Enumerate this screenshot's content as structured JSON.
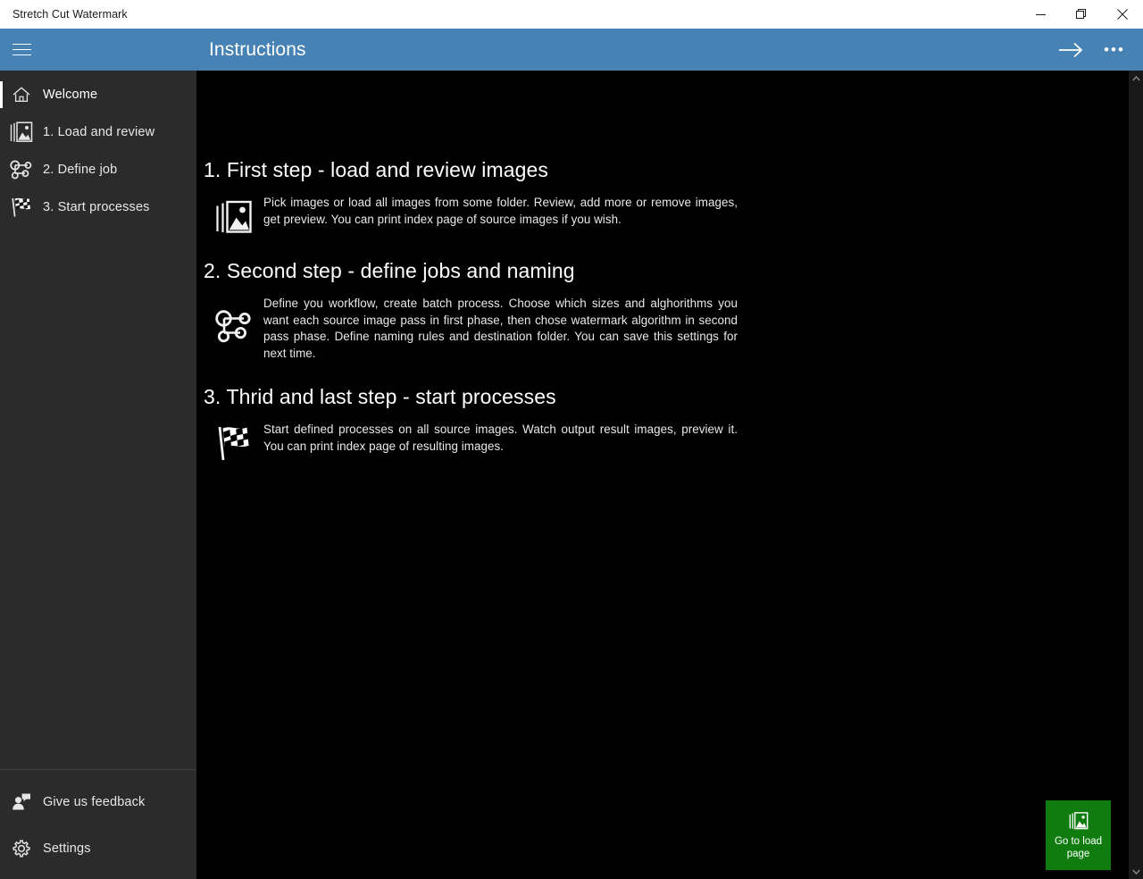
{
  "window": {
    "title": "Stretch Cut Watermark",
    "controls": [
      {
        "name": "minimize",
        "label": "—"
      },
      {
        "name": "maximize",
        "label": "❐"
      },
      {
        "name": "close",
        "label": "✕"
      }
    ]
  },
  "appbar": {
    "menu_icon": "hamburger-icon",
    "title": "Instructions",
    "forward_icon": "arrow-right-icon",
    "more_label": "•••"
  },
  "sidebar": {
    "items": [
      {
        "label": "Welcome",
        "icon": "home-icon",
        "selected": true
      },
      {
        "label": "1. Load and review",
        "icon": "images-icon",
        "selected": false
      },
      {
        "label": "2. Define job",
        "icon": "share-nodes-icon",
        "selected": false
      },
      {
        "label": "3. Start processes",
        "icon": "checkered-flag-icon",
        "selected": false
      }
    ],
    "bottom_items": [
      {
        "label": "Give us feedback",
        "icon": "feedback-person-icon"
      },
      {
        "label": "Settings",
        "icon": "gear-icon"
      }
    ]
  },
  "main": {
    "sections": [
      {
        "title": "1. First step - load and review images",
        "icon": "images-icon",
        "text": "Pick images or load all images from some folder. Review, add more or remove images, get preview. You can print index page of source images if you wish."
      },
      {
        "title": "2. Second step - define jobs and naming",
        "icon": "share-nodes-icon",
        "text": "Define you workflow, create batch process. Choose which sizes and alghorithms you want each source image pass in first phase, then chose watermark algorithm in second pass phase. Define naming rules and destination folder. You can save this settings for next time."
      },
      {
        "title": "3. Thrid and last step - start processes",
        "icon": "checkered-flag-icon",
        "text": "Start defined processes on all source images. Watch output result images, preview it. You can print index page of resulting images."
      }
    ]
  },
  "cta": {
    "label": "Go to load page",
    "icon": "images-icon",
    "color": "#107c10"
  },
  "colors": {
    "accent_blue": "#4682b4",
    "sidebar_bg": "#2b2b2b",
    "content_bg": "#000000",
    "cta_green": "#107c10"
  }
}
